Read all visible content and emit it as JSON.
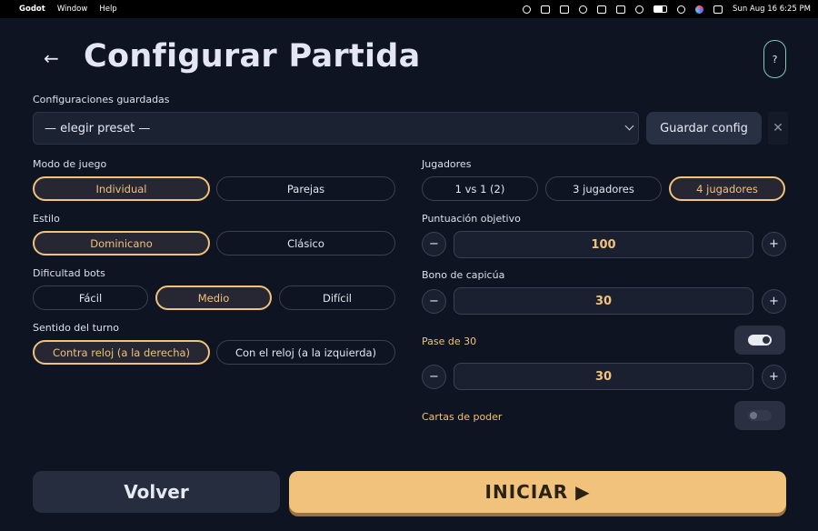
{
  "menubar": {
    "app": "Godot",
    "menus": [
      "Window",
      "Help"
    ],
    "clock": "Sun Aug 16  6:25 PM"
  },
  "header": {
    "back_glyph": "←",
    "title": "Configurar Partida",
    "help_label": "?"
  },
  "presets": {
    "label": "Configuraciones guardadas",
    "selected": "— elegir preset —",
    "save_label": "Guardar config",
    "clear_glyph": "✕"
  },
  "mode": {
    "label": "Modo de juego",
    "options": [
      "Individual",
      "Parejas"
    ],
    "selected": "Individual"
  },
  "style": {
    "label": "Estilo",
    "options": [
      "Dominicano",
      "Clásico"
    ],
    "selected": "Dominicano"
  },
  "difficulty": {
    "label": "Dificultad bots",
    "options": [
      "Fácil",
      "Medio",
      "Difícil"
    ],
    "selected": "Medio"
  },
  "turn": {
    "label": "Sentido del turno",
    "options": [
      "Contra reloj (a la derecha)",
      "Con el reloj (a la izquierda)"
    ],
    "selected": "Contra reloj (a la derecha)"
  },
  "players": {
    "label": "Jugadores",
    "options": [
      "1 vs 1 (2)",
      "3 jugadores",
      "4 jugadores"
    ],
    "selected": "4 jugadores"
  },
  "target_score": {
    "label": "Puntuación objetivo",
    "value": "100",
    "minus": "−",
    "plus": "+"
  },
  "capicua_bonus": {
    "label": "Bono de capicúa",
    "value": "30",
    "minus": "−",
    "plus": "+"
  },
  "pase": {
    "label": "Pase de 30",
    "enabled": true,
    "value": "30",
    "minus": "−",
    "plus": "+"
  },
  "power_cards": {
    "label": "Cartas de poder",
    "enabled": false
  },
  "footer": {
    "back_label": "Volver",
    "start_label": "INICIAR ▶"
  },
  "colors": {
    "background": "#0e1422",
    "accent": "#f0c27b",
    "help_border": "#7fc9b4"
  }
}
